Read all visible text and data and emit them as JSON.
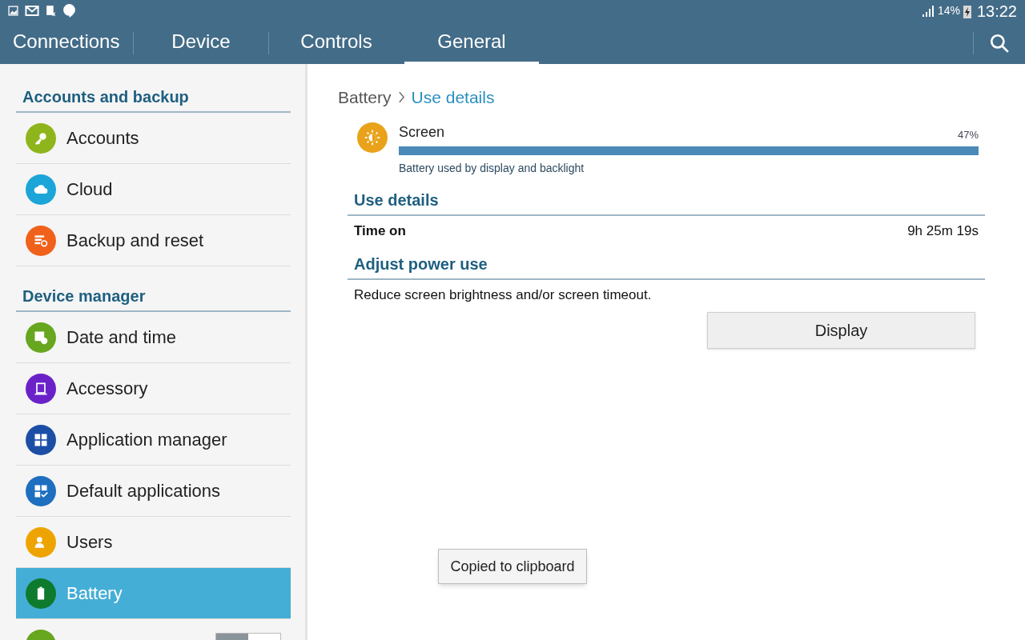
{
  "status_bar": {
    "battery_percent": "14%",
    "time": "13:22"
  },
  "tabs": [
    {
      "label": "Connections",
      "selected": false
    },
    {
      "label": "Device",
      "selected": false
    },
    {
      "label": "Controls",
      "selected": false
    },
    {
      "label": "General",
      "selected": true
    }
  ],
  "sidebar": {
    "sections": [
      {
        "title": "Accounts and backup",
        "items": [
          {
            "label": "Accounts",
            "color": "#8fb51c",
            "selected": false,
            "kind": "link"
          },
          {
            "label": "Cloud",
            "color": "#1ba5d8",
            "selected": false,
            "kind": "link"
          },
          {
            "label": "Backup and reset",
            "color": "#f0621b",
            "selected": false,
            "kind": "link"
          }
        ]
      },
      {
        "title": "Device manager",
        "items": [
          {
            "label": "Date and time",
            "color": "#67a61f",
            "selected": false,
            "kind": "link"
          },
          {
            "label": "Accessory",
            "color": "#6a22c8",
            "selected": false,
            "kind": "link"
          },
          {
            "label": "Application manager",
            "color": "#1d4ea6",
            "selected": false,
            "kind": "link"
          },
          {
            "label": "Default applications",
            "color": "#1e6fc0",
            "selected": false,
            "kind": "link"
          },
          {
            "label": "Users",
            "color": "#eea400",
            "selected": false,
            "kind": "link"
          },
          {
            "label": "Battery",
            "color": "#0d7a2e",
            "selected": true,
            "kind": "link"
          },
          {
            "color": "#67a61f",
            "selected": false,
            "kind": "toggle",
            "on": false
          }
        ]
      }
    ]
  },
  "breadcrumb": [
    "Battery",
    "Use details"
  ],
  "usage": {
    "name": "Screen",
    "percent": "47%",
    "level": 1,
    "description": "Battery used by display and backlight"
  },
  "use_details": {
    "title": "Use details",
    "rows": [
      {
        "label": "Time on",
        "value": "9h 25m 19s"
      }
    ]
  },
  "adjust": {
    "title": "Adjust power use",
    "text": "Reduce screen brightness and/or screen timeout.",
    "button": "Display"
  },
  "toast": "Copied to clipboard"
}
